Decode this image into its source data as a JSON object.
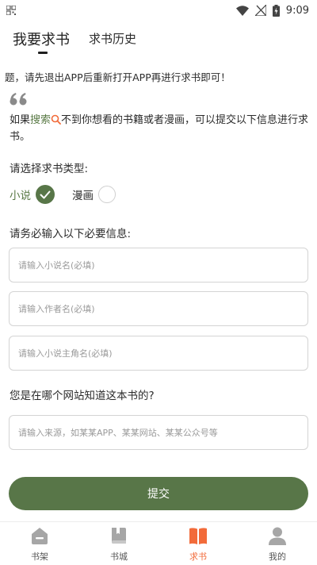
{
  "status_bar": {
    "time": "9:09",
    "icons": [
      "qr-icon",
      "wifi-icon",
      "no-signal-icon",
      "battery-charging-icon"
    ]
  },
  "tabs": [
    {
      "label": "我要求书",
      "active": true
    },
    {
      "label": "求书历史",
      "active": false
    }
  ],
  "notice": "题，请先退出APP后重新打开APP再进行求书即可！",
  "info": {
    "prefix": "如果",
    "link": "搜索",
    "suffix": "不到你想看的书籍或者漫画，可以提交以下信息进行求书。"
  },
  "type_section": {
    "label": "请选择求书类型:",
    "options": [
      {
        "label": "小说",
        "selected": true
      },
      {
        "label": "漫画",
        "selected": false
      }
    ]
  },
  "required_section": {
    "label": "请务必输入以下必要信息:",
    "fields": [
      {
        "placeholder": "请输入小说名(必填)",
        "value": ""
      },
      {
        "placeholder": "请输入作者名(必填)",
        "value": ""
      },
      {
        "placeholder": "请输入小说主角名(必填)",
        "value": ""
      }
    ]
  },
  "source_section": {
    "label": "您是在哪个网站知道这本书的?",
    "placeholder": "请输入来源，如某某APP、某某网站、某某公众号等",
    "value": ""
  },
  "submit_label": "提交",
  "bottom_nav": [
    {
      "label": "书架",
      "icon": "bookshelf-icon",
      "active": false
    },
    {
      "label": "书城",
      "icon": "book-store-icon",
      "active": false
    },
    {
      "label": "求书",
      "icon": "request-book-icon",
      "active": true
    },
    {
      "label": "我的",
      "icon": "profile-icon",
      "active": false
    }
  ],
  "colors": {
    "accent_green": "#587648",
    "active_orange": "#f26b3a",
    "inactive_gray": "#a6a6a6"
  }
}
